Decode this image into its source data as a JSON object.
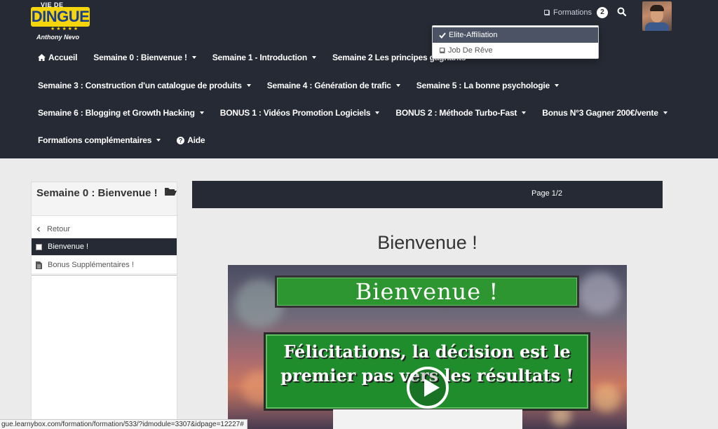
{
  "brand": {
    "top": "VIE DE",
    "main": "DINGUE",
    "stars": "★ ★ ★ ★ ★",
    "sub": "Anthony Nevo"
  },
  "header": {
    "formations_label": "Formations",
    "formations_count": "2"
  },
  "formations_dropdown": [
    {
      "label": "Elite-Affiliation",
      "icon": "check-icon",
      "active": true
    },
    {
      "label": "Job De Rêve",
      "icon": "book-icon",
      "active": false
    }
  ],
  "menu": {
    "row1": [
      {
        "label": "Accueil",
        "icon": "home-icon",
        "caret": false
      },
      {
        "label": "Semaine 0 : Bienvenue !",
        "caret": true
      },
      {
        "label": "Semaine 1 - Introduction",
        "caret": true
      },
      {
        "label": "Semaine 2 Les principes gagnants",
        "caret": false
      }
    ],
    "row2": [
      {
        "label": "Semaine 3 : Construction d'un catalogue de produits",
        "caret": true
      },
      {
        "label": "Semaine 4 : Génération de trafic",
        "caret": true
      },
      {
        "label": "Semaine 5 : La bonne psychologie",
        "caret": true
      }
    ],
    "row3": [
      {
        "label": "Semaine 6 : Blogging et Growth Hacking",
        "caret": true
      },
      {
        "label": "BONUS 1 : Vidéos Promotion Logiciels",
        "caret": true
      },
      {
        "label": "BONUS 2 : Méthode Turbo-Fast",
        "caret": true
      },
      {
        "label": "Bonus N°3 Gagner 200€/vente",
        "caret": true
      }
    ],
    "row4": [
      {
        "label": "Formations complémentaires",
        "caret": true
      },
      {
        "label": "Aide",
        "icon": "question-icon",
        "caret": false
      }
    ]
  },
  "sidebar": {
    "title": "Semaine 0 : Bienvenue !",
    "items": [
      {
        "label": "Retour",
        "icon": "chevron-left-icon"
      },
      {
        "label": "Bienvenue !",
        "icon": "checkbox-icon",
        "active": true
      },
      {
        "label": "Bonus Supplémentaires !",
        "icon": "file-icon"
      }
    ]
  },
  "main": {
    "pager": "Page 1/2",
    "title": "Bienvenue !",
    "video": {
      "banner1": "Bienvenue !",
      "banner2": "Félicitations, la décision est le premier pas vers les résultats !"
    }
  },
  "status_bar": {
    "url": "gue.learnybox.com/formation/formation/533/?idmodule=3307&idpage=12227#"
  },
  "colors": {
    "navbar": "#252a34",
    "accent_green": "#2d9630",
    "logo_yellow": "#f5d60c"
  }
}
